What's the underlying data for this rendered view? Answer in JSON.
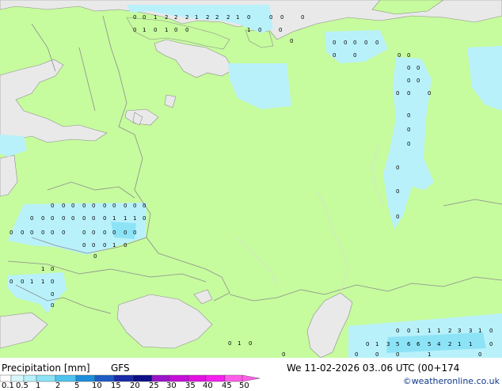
{
  "map": {
    "model": "GFS",
    "colors": {
      "land": "#c6fb9e",
      "sea": "#e9e9e9",
      "precip_light": "#b9f1fb",
      "precip_med": "#8de3f6",
      "border": "#8d8d8d"
    },
    "grid_values": [
      {
        "group": "north-coast",
        "values": [
          "0",
          "0",
          "1",
          "2",
          "2",
          "2",
          "1",
          "2",
          "2",
          "2",
          "1",
          "0",
          "0",
          "0",
          "0"
        ]
      },
      {
        "group": "north-row2",
        "values": [
          "0",
          "1",
          "0",
          "1",
          "0",
          "0",
          "1",
          "0",
          "0",
          "0"
        ]
      },
      {
        "group": "urals",
        "values": [
          "0",
          "0",
          "0",
          "0",
          "0",
          "0",
          "0",
          "0",
          "0",
          "0",
          "0",
          "0",
          "0",
          "0",
          "0",
          "0",
          "0",
          "0",
          "0",
          "0",
          "0",
          "0"
        ]
      },
      {
        "group": "belarus-row1",
        "values": [
          "0",
          "0",
          "0",
          "0",
          "0",
          "0",
          "0",
          "0",
          "0",
          "0"
        ]
      },
      {
        "group": "belarus-row2",
        "values": [
          "0",
          "0",
          "0",
          "0",
          "0",
          "0",
          "0",
          "0",
          "1",
          "1",
          "1",
          "0"
        ]
      },
      {
        "group": "belarus-row3",
        "values": [
          "0",
          "0",
          "0",
          "0",
          "0",
          "0",
          "0",
          "0",
          "0",
          "0",
          "0",
          "0"
        ]
      },
      {
        "group": "belarus-row4",
        "values": [
          "0",
          "0",
          "0",
          "1",
          "0",
          "0"
        ]
      },
      {
        "group": "ukraine",
        "values": [
          "1",
          "0",
          "0",
          "0",
          "1",
          "1",
          "0",
          "0",
          "0"
        ]
      },
      {
        "group": "kazakh-row1",
        "values": [
          "0",
          "0",
          "1",
          "1",
          "1",
          "2",
          "3",
          "3",
          "1",
          "0"
        ]
      },
      {
        "group": "kazakh-row2",
        "values": [
          "0",
          "1",
          "3",
          "5",
          "6",
          "6",
          "5",
          "4",
          "2",
          "1",
          "1",
          "0"
        ]
      },
      {
        "group": "kazakh-row3",
        "values": [
          "0",
          "1",
          "0",
          "0",
          "0",
          "0",
          "0",
          "1",
          "0"
        ]
      }
    ]
  },
  "legend": {
    "title": "Precipitation [mm]",
    "model": "GFS",
    "ticks": [
      "0.1",
      "0.5",
      "1",
      "2",
      "5",
      "10",
      "15",
      "20",
      "25",
      "30",
      "35",
      "40",
      "45",
      "50"
    ],
    "colors": [
      "#ffffff",
      "#d8f8fd",
      "#b9f1fb",
      "#8de3f6",
      "#4fc3ee",
      "#1c8fdb",
      "#1e5cc4",
      "#1a2aa8",
      "#0f0f86",
      "#9b14c9",
      "#c410d9",
      "#e212e2",
      "#f61ff0",
      "#ff5ee8"
    ]
  },
  "footer": {
    "datetime": "We 11-02-2026 03..06 UTC (00+174",
    "credit": "©weatheronline.co.uk"
  }
}
